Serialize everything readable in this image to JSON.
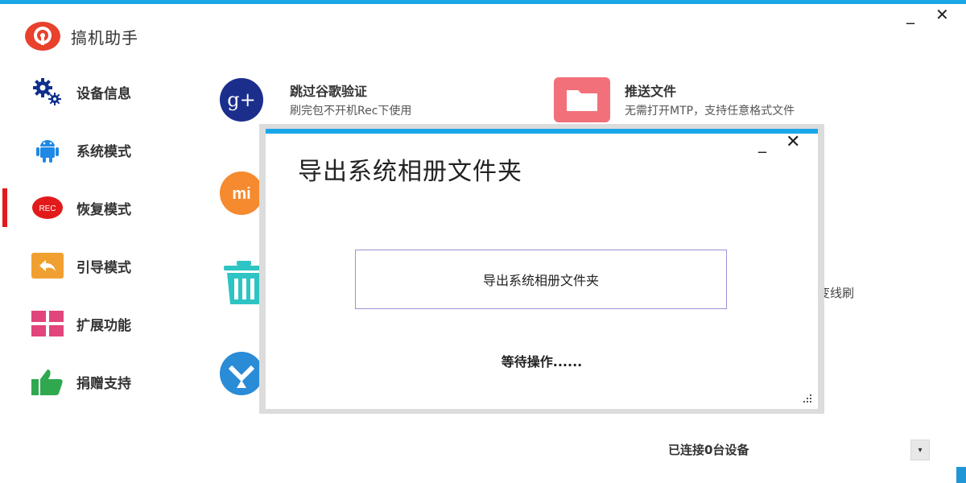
{
  "app": {
    "title": "搞机助手",
    "window_controls": {
      "minimize": "_",
      "close": "✕"
    }
  },
  "colors": {
    "accent": "#1aa7e8",
    "active_indicator": "#e21a1a",
    "dialog_button_border": "#9b93d6"
  },
  "sidebar": {
    "items": [
      {
        "label": "设备信息",
        "icon": "gear-icon"
      },
      {
        "label": "系统模式",
        "icon": "android-icon"
      },
      {
        "label": "恢复模式",
        "icon": "rec-icon",
        "icon_text": "REC",
        "active": true
      },
      {
        "label": "引导模式",
        "icon": "back-arrow-icon"
      },
      {
        "label": "扩展功能",
        "icon": "grid-icon"
      },
      {
        "label": "捐赠支持",
        "icon": "thumbs-up-icon"
      }
    ]
  },
  "features": {
    "google": {
      "icon": "google-plus-icon",
      "icon_text": "g+",
      "title": "跳过谷歌验证",
      "desc": "刷完包不开机Rec下使用"
    },
    "push_file": {
      "icon": "folder-icon",
      "title": "推送文件",
      "desc": "无需打开MTP，支持任意格式文件"
    },
    "xiaomi": {
      "icon": "xiaomi-icon",
      "icon_text": "mi"
    },
    "trash": {
      "icon": "trash-icon"
    },
    "twrp": {
      "icon": "twrp-icon"
    },
    "partial_text": "变线刷"
  },
  "status_bar": {
    "text": "已连接0台设备",
    "dropdown": "▾"
  },
  "dialog": {
    "title": "导出系统相册文件夹",
    "button_label": "导出系统相册文件夹",
    "status": "等待操作......",
    "controls": {
      "minimize": "_",
      "close": "✕"
    }
  }
}
